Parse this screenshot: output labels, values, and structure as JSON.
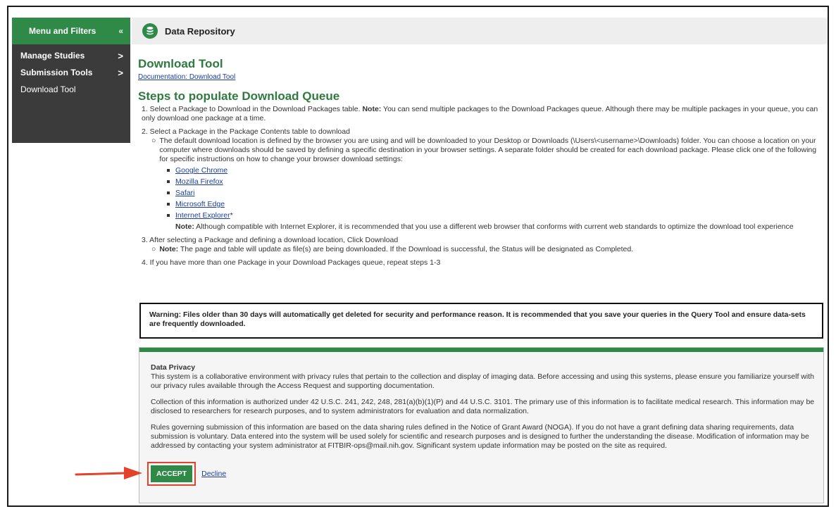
{
  "sidebar": {
    "header": "Menu and Filters",
    "chevron": "«",
    "items": [
      {
        "label": "Manage Studies",
        "arrow": ">"
      },
      {
        "label": "Submission Tools",
        "arrow": ">"
      },
      {
        "label": "Download Tool",
        "arrow": ""
      }
    ]
  },
  "topbar": {
    "title": "Data Repository"
  },
  "main": {
    "title": "Download Tool",
    "doc_link": "Documentation: Download Tool",
    "steps_title": "Steps to populate Download Queue",
    "step1": {
      "prefix": "1. Select a Package to Download in the Download Packages table. ",
      "note": "Note:",
      "text": " You can send multiple packages to the Download Packages queue. Although there may be multiple packages in your queue, you can only download one package at a time."
    },
    "step2": {
      "text": "2. Select a Package in the Package Contents table to download",
      "sub": "The default download location is defined by the browser you are using and will be downloaded to your Desktop or Downloads (\\Users\\<username>\\Downloads) folder. You can choose a location on your computer where downloads should be saved by defining a specific destination in your browser settings. A separate folder should be created for each download package. Please click one of the following for specific instructions on how to change your browser download settings:",
      "links": [
        "Google Chrome",
        "Mozilla Firefox",
        "Safari",
        "Microsoft Edge",
        "Internet Explorer"
      ],
      "ie_asterisk": "*",
      "ie_note_label": "Note:",
      "ie_note": " Although compatible with Internet Explorer, it is recommended that you use a different web browser that conforms with current web standards to optimize the download tool experience"
    },
    "step3": {
      "text": "3. After selecting a Package and defining a download location, Click Download",
      "note_label": "Note:",
      "note": " The page and table will update as file(s) are being downloaded. If the Download is successful, the Status will be designated as Completed."
    },
    "step4": {
      "text": "4. If you have more than one Package in your Download Packages queue, repeat steps 1-3"
    }
  },
  "warning": "Warning: Files older than 30 days will automatically get deleted for security and performance reason. It is recommended that you save your queries in the Query Tool and ensure data-sets are frequently downloaded.",
  "privacy": {
    "title": "Data Privacy",
    "p1": "This system is a collaborative environment with privacy rules that pertain to the collection and display of imaging data. Before accessing and using this systems, please ensure you familiarize yourself with our privacy rules available through the Access Request and supporting documentation.",
    "p2": "Collection of this information is authorized under 42 U.S.C. 241, 242, 248, 281(a)(b)(1)(P) and 44 U.S.C. 3101. The primary use of this information is to facilitate medical research. This information may be disclosed to researchers for research purposes, and to system administrators for evaluation and data normalization.",
    "p3": "Rules governing submission of this information are based on the data sharing rules defined in the Notice of Grant Award (NOGA). If you do not have a grant defining data sharing requirements, data submission is voluntary. Data entered into the system will be used solely for scientific and research purposes and is designed to further the understanding the disease. Modification of information may be addressed by contacting your system administrator at FITBIR-ops@mail.nih.gov. Significant system update information may be posted on the site as required.",
    "accept_label": "ACCEPT",
    "decline_label": "Decline"
  },
  "colors": {
    "brand_green": "#2f8a47",
    "sidebar_dark": "#3b3b3b",
    "highlight_red": "#e2432a"
  }
}
